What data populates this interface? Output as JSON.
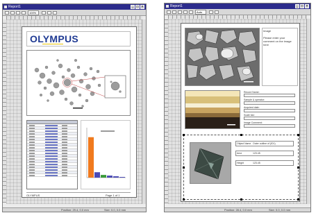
{
  "colors": {
    "titlebar": "#2c2c8c",
    "logo": "#1f3a93",
    "bar_orange": "#f07a1e",
    "bar_blue": "#4a4ab4",
    "bar_green": "#3a9a3a"
  },
  "left_window": {
    "title": "Report1",
    "zoom": "100%",
    "page": {
      "logo_text": "OLYMPUS",
      "footer_left": "OLYMPUS",
      "footer_right": "Page 1 of 1"
    },
    "chart_data": {
      "type": "bar",
      "title": "",
      "categories": [
        "",
        "",
        "",
        "",
        "",
        ""
      ],
      "values": [
        60,
        8,
        4,
        3,
        2,
        1
      ],
      "ylim": [
        0,
        70
      ]
    },
    "status": {
      "left": "",
      "mid": "Position: 29.4, 0.0 mm",
      "right": "Size: 0.0, 0.0 mm"
    }
  },
  "right_window": {
    "title": "Report1",
    "zoom": "Auto",
    "page": {
      "image_label": "Image",
      "image_caption": "Please enter your comment on the image here",
      "fields": [
        {
          "label": "Record Name:",
          "value": ""
        },
        {
          "label": "Sample & operator:",
          "value": ""
        },
        {
          "label": "Acquired date:",
          "value": ""
        },
        {
          "label": "Scale bar:",
          "value": ""
        },
        {
          "label": "Image Comment:",
          "value": ""
        }
      ],
      "measure_rows": [
        {
          "label": "Object Name",
          "value": "Outer outline of (ID1)"
        },
        {
          "label": "Area",
          "value": "123.45"
        },
        {
          "label": "Height",
          "value": "123.45"
        }
      ]
    },
    "status": {
      "mid": "Position: 28.4, 0.0 mm",
      "right": "Size: 0.0, 0.0 mm"
    }
  }
}
